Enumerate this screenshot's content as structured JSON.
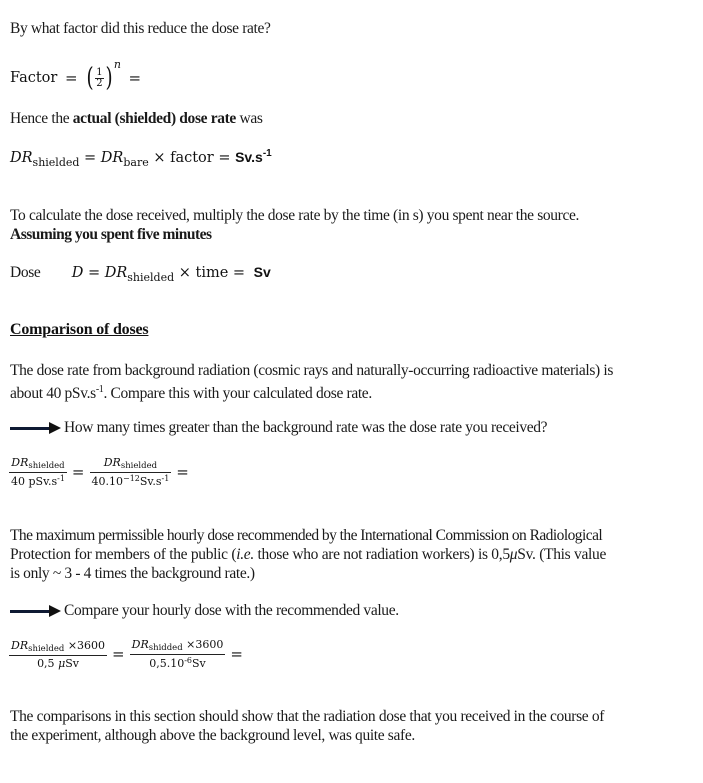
{
  "question_factor": "By what factor did this reduce the dose rate?",
  "factor_eq": {
    "label": "Factor",
    "equals": "=",
    "half_num": "1",
    "half_den": "2",
    "exponent": "n",
    "equals2": "="
  },
  "hence": {
    "prefix": "Hence the ",
    "bold": "actual (shielded) dose rate",
    "suffix": " was"
  },
  "dr_eq": {
    "dr": "DR",
    "sub_shielded": "shielded",
    "equals": "=",
    "sub_bare": "bare",
    "times_factor": "× factor =",
    "unit": "Sv.s",
    "unit_exp": "-1"
  },
  "dose_intro": {
    "line1": "To calculate the dose received, multiply the dose rate by the time (in s) you spent near the source.",
    "line2_bold": "Assuming you spent five minutes"
  },
  "dose_eq": {
    "label": "Dose",
    "d": "D",
    "equals": "=",
    "dr": "DR",
    "sub": "shielded",
    "times": "× time =",
    "unit": "Sv"
  },
  "section_heading": "Comparison of doses",
  "background": {
    "line1": "The dose rate from background radiation (cosmic rays and naturally-occurring radioactive materials) is",
    "line2_prefix": "about 40 pSv.s",
    "line2_exp": "-1",
    "line2_suffix": ". Compare this with your calculated dose rate."
  },
  "task1": "How many times greater than the background rate was the dose rate you received?",
  "ratio_eq": {
    "num1_dr": "DR",
    "num1_sub": "shielded",
    "den1": "40 pSv.s",
    "den1_exp": "-1",
    "num2_dr": "DR",
    "num2_sub": "shielded",
    "den2_prefix": "40.10",
    "den2_exp": "−12",
    "den2_unit": "Sv.s",
    "den2_unit_exp": "-1",
    "equals": "="
  },
  "icrp": {
    "line1": "The maximum permissible hourly dose recommended by the International Commission on Radiological",
    "line2_prefix": "Protection for members of the public (",
    "line2_italic": "i.e.",
    "line2_mid": " those who are not radiation workers) is 0,5",
    "line2_mu": "μ",
    "line2_suffix": "Sv. (This value",
    "line3": "is only ~ 3 - 4 times the background rate.)"
  },
  "task2": "Compare your hourly dose with the recommended value.",
  "hourly_eq": {
    "dr": "DR",
    "sub1": "shielded",
    "times1": " ×3600",
    "den1_prefix": "0,5 ",
    "den1_mu": "μ",
    "den1_unit": "Sv",
    "sub2": "shidded",
    "times2": " ×3600",
    "den2_prefix": "0,5.10",
    "den2_exp": "-6",
    "den2_unit": "Sv",
    "equals": "="
  },
  "conclusion": {
    "line1": "The comparisons in this section should show that the radiation dose that you received in the course of",
    "line2": "the experiment, although above the background level, was quite safe."
  }
}
